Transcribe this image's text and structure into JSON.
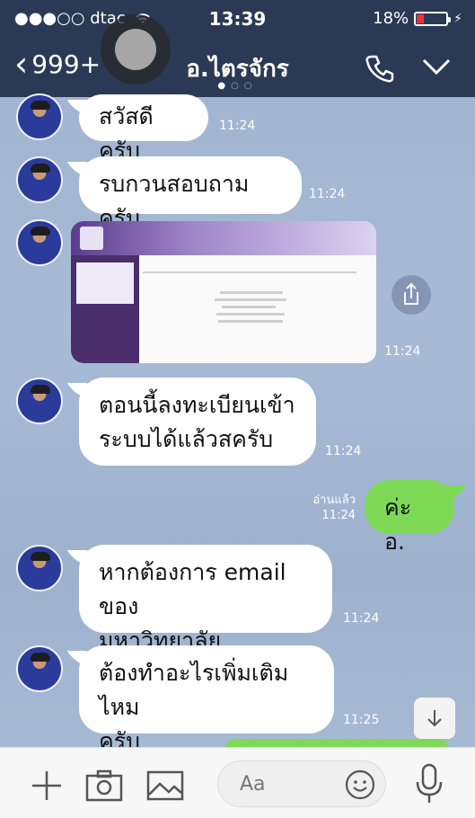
{
  "status": {
    "carrier": "●●●○○ dtac",
    "time": "13:39",
    "battery": "18%"
  },
  "nav": {
    "back_label": "999+",
    "title": "อ.ไตรจักร"
  },
  "messages": [
    {
      "text": "สวัสดีครับ",
      "time": "11:24"
    },
    {
      "text": "รบกวนสอบถามครับ",
      "time": "11:24"
    },
    {
      "image_time": "11:24"
    },
    {
      "text_line1": "ตอนนี้ลงทะเบียนเข้า",
      "text_line2": "ระบบได้แล้วสครับ",
      "time": "11:24"
    },
    {
      "read_label": "อ่านแล้ว",
      "time": "11:24",
      "text": "ค่ะ อ."
    },
    {
      "text_line1": "หากต้องการ email ของ",
      "text_line2": "มหาวิทยาลัย",
      "time": "11:24"
    },
    {
      "text_line1": "ต้องทำอะไรเพิ่มเติมไหม",
      "text_line2": "ครับ",
      "time": "11:25"
    }
  ],
  "input": {
    "placeholder": "Aa"
  },
  "icons": [
    "wifi-icon",
    "battery-icon",
    "back-chevron-icon",
    "assistive-touch-icon",
    "phone-icon",
    "chevron-down-icon",
    "share-icon",
    "arrow-down-icon",
    "plus-icon",
    "camera-icon",
    "image-icon",
    "emoji-icon",
    "microphone-icon"
  ],
  "colors": {
    "navbar": "#2a3a55",
    "outgoing_bubble": "#7ed957",
    "incoming_bubble": "#ffffff"
  }
}
